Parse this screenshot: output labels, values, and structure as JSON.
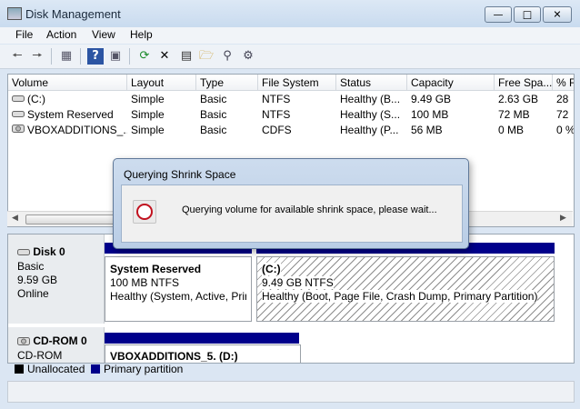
{
  "window": {
    "title": "Disk Management"
  },
  "menu": [
    "File",
    "Action",
    "View",
    "Help"
  ],
  "toolbar": {
    "icons": [
      "back-icon",
      "forward-icon",
      "properties-view-icon",
      "help-icon",
      "show-hide-icon",
      "refresh-icon",
      "delete-icon",
      "new-volume-icon",
      "open-icon",
      "find-icon",
      "settings-icon"
    ]
  },
  "table": {
    "columns": [
      "Volume",
      "Layout",
      "Type",
      "File System",
      "Status",
      "Capacity",
      "Free Spa...",
      "% F"
    ],
    "rows": [
      [
        "(C:)",
        "Simple",
        "Basic",
        "NTFS",
        "Healthy (B...",
        "9.49 GB",
        "2.63 GB",
        "28"
      ],
      [
        "System Reserved",
        "Simple",
        "Basic",
        "NTFS",
        "Healthy (S...",
        "100 MB",
        "72 MB",
        "72"
      ],
      [
        "VBOXADDITIONS_...",
        "Simple",
        "Basic",
        "CDFS",
        "Healthy (P...",
        "56 MB",
        "0 MB",
        "0 %"
      ]
    ]
  },
  "disks": {
    "disk0": {
      "name": "Disk 0",
      "type": "Basic",
      "size": "9.59 GB",
      "state": "Online",
      "partitions": [
        {
          "title": "System Reserved",
          "size": "100 MB NTFS",
          "status": "Healthy (System, Active, Prir"
        },
        {
          "title": "(C:)",
          "size": "9.49 GB NTFS",
          "status": "Healthy (Boot, Page File, Crash Dump, Primary Partition)"
        }
      ]
    },
    "cdrom0": {
      "name": "CD-ROM 0",
      "type": "CD-ROM",
      "partition_title": "VBOXADDITIONS_5.  (D:)"
    }
  },
  "legend": [
    {
      "label": "Unallocated",
      "color": "#000000"
    },
    {
      "label": "Primary partition",
      "color": "#00008b"
    }
  ],
  "dialog": {
    "title": "Querying Shrink Space",
    "message": "Querying volume for available shrink space, please wait..."
  }
}
